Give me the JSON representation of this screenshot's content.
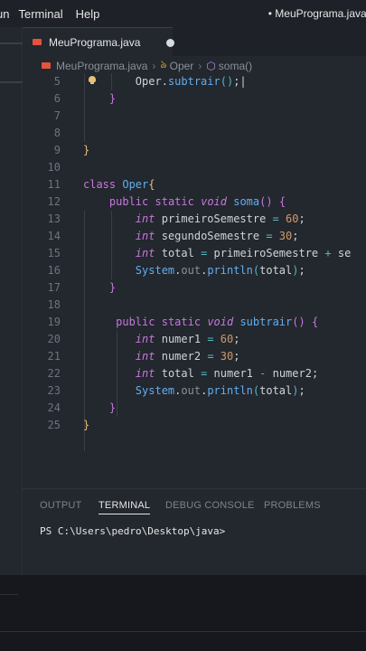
{
  "menubar": {
    "run": "un",
    "terminal": "Terminal",
    "help": "Help",
    "window_title": "• MeuPrograma.java -"
  },
  "tab": {
    "label": "MeuPrograma.java"
  },
  "breadcrumb": {
    "file": "MeuPrograma.java",
    "class": "Oper",
    "method": "soma()"
  },
  "code_lines": {
    "l5": "5",
    "l6": "6",
    "l7": "7",
    "l8": "8",
    "l9": "9",
    "l10": "10",
    "l11": "11",
    "l12": "12",
    "l13": "13",
    "l14": "14",
    "l15": "15",
    "l16": "16",
    "l17": "17",
    "l18": "18",
    "l19": "19",
    "l20": "20",
    "l21": "21",
    "l22": "22",
    "l23": "23",
    "l24": "24",
    "l25": "25"
  },
  "code": {
    "oper": "Oper",
    "subtrair": "subtrair",
    "class_kw": "class",
    "public": "public",
    "static": "static",
    "void": "void",
    "soma": "soma",
    "int": "int",
    "primeiroSemestre": "primeiroSemestre",
    "segundoSemestre": "segundoSemestre",
    "total": "total",
    "system": "System",
    "out": "out",
    "println": "println",
    "numer1": "numer1",
    "numer2": "numer2",
    "val60": "60",
    "val30": "30",
    "se": "se"
  },
  "panel": {
    "tabs": {
      "output": "OUTPUT",
      "terminal": "TERMINAL",
      "debug": "DEBUG CONSOLE",
      "problems": "PROBLEMS"
    },
    "prompt": "PS C:\\Users\\pedro\\Desktop\\java>"
  },
  "colors": {
    "keyword": "#c678dd",
    "function": "#61afef",
    "number": "#d19a66",
    "operator": "#56b6c2",
    "editor_bg": "#23272e"
  },
  "icons": {
    "file": "java-file-icon",
    "class": "class-icon",
    "method": "method-icon",
    "dirty": "unsaved-dot-icon",
    "lightbulb": "lightbulb-icon"
  }
}
